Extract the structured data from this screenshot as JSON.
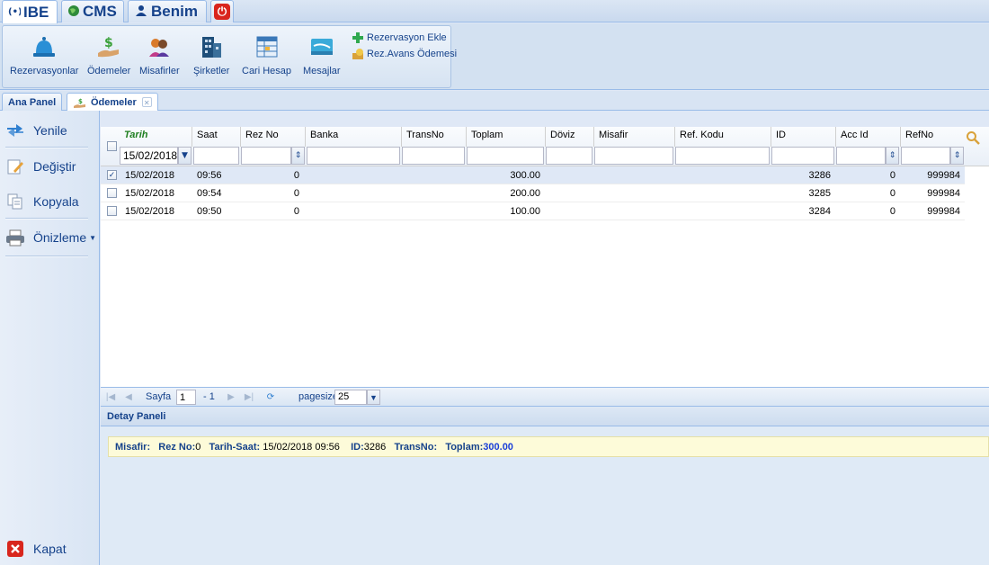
{
  "top_tabs": [
    {
      "label": "IBE",
      "icon": "ibe-logo-icon"
    },
    {
      "label": "CMS",
      "icon": "globe-icon"
    },
    {
      "label": "Benim",
      "icon": "users-icon"
    }
  ],
  "ribbon": {
    "buttons": [
      {
        "label": "Rezervasyonlar",
        "icon": "bell-icon"
      },
      {
        "label": "Ödemeler",
        "icon": "payment-hand-icon"
      },
      {
        "label": "Misafirler",
        "icon": "guests-icon"
      },
      {
        "label": "Şirketler",
        "icon": "building-icon"
      },
      {
        "label": "Cari Hesap",
        "icon": "ledger-icon"
      },
      {
        "label": "Mesajlar",
        "icon": "message-icon"
      }
    ],
    "small_buttons": [
      {
        "label": "Rezervasyon Ekle",
        "icon": "plus-icon"
      },
      {
        "label": "Rez.Avans Ödemesi",
        "icon": "coins-icon"
      }
    ]
  },
  "panel_tabs": [
    {
      "label": "Ana Panel"
    },
    {
      "label": "Ödemeler",
      "icon": "payment-hand-icon"
    }
  ],
  "sidebar": {
    "refresh": "Yenile",
    "edit": "Değiştir",
    "copy": "Kopyala",
    "preview": "Önizleme",
    "close": "Kapat"
  },
  "grid": {
    "columns": [
      "Tarih",
      "Saat",
      "Rez No",
      "Banka",
      "TransNo",
      "Toplam",
      "Döviz",
      "Misafir",
      "Ref. Kodu",
      "ID",
      "Acc Id",
      "RefNo"
    ],
    "filter_date": "15/02/2018",
    "rows": [
      {
        "checked": true,
        "tarih": "15/02/2018",
        "saat": "09:56",
        "rez_no": "0",
        "toplam": "300.00",
        "id": "3286",
        "acc_id": "0",
        "ref_no": "999984"
      },
      {
        "checked": false,
        "tarih": "15/02/2018",
        "saat": "09:54",
        "rez_no": "0",
        "toplam": "200.00",
        "id": "3285",
        "acc_id": "0",
        "ref_no": "999984"
      },
      {
        "checked": false,
        "tarih": "15/02/2018",
        "saat": "09:50",
        "rez_no": "0",
        "toplam": "100.00",
        "id": "3284",
        "acc_id": "0",
        "ref_no": "999984"
      }
    ]
  },
  "pager": {
    "page_label": "Sayfa",
    "page_value": "1",
    "of_text": "- 1",
    "pagesize_label": "pagesize",
    "pagesize_value": "25"
  },
  "detail": {
    "title": "Detay Paneli",
    "misafir_label": "Misafir:",
    "rez_label": "Rez No:",
    "rez_value": "0",
    "tarih_label": "Tarih-Saat:",
    "tarih_value": "15/02/2018 09:56",
    "id_label": "ID:",
    "id_value": "3286",
    "trans_label": "TransNo:",
    "toplam_label": "Toplam:",
    "toplam_value": "300.00"
  },
  "colors": {
    "accent": "#15428b",
    "selected_row": "#dfe8f6",
    "detail_bg": "#fdfbd9",
    "sorted_header": "#1f7f1f"
  }
}
